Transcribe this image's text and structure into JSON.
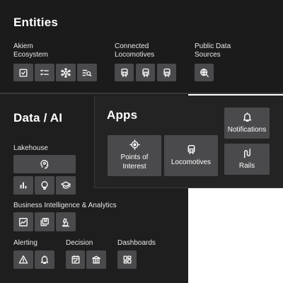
{
  "entities": {
    "title": "Entities",
    "akiem": {
      "label_line1": "Akiem",
      "label_line2": "Ecosystem",
      "icons": [
        "checkbox-icon",
        "checklist-icon",
        "network-hub-icon",
        "list-search-icon"
      ]
    },
    "connected": {
      "label_line1": "Connected",
      "label_line2": "Locomotives",
      "icons": [
        "train-front-icon",
        "train-front-icon",
        "train-front-icon"
      ]
    },
    "public": {
      "label_line1": "Public Data",
      "label_line2": "Sources",
      "icons": [
        "globe-search-icon"
      ]
    }
  },
  "data_ai": {
    "title": "Data / AI",
    "lakehouse": {
      "label": "Lakehouse",
      "icons": [
        "brain-head-icon",
        "bar-chart-icon",
        "lightbulb-icon",
        "graduation-cap-icon"
      ]
    },
    "bi": {
      "label": "Business Intelligence & Analytics",
      "icons": [
        "line-chart-icon",
        "layers-icon",
        "microscope-icon"
      ]
    },
    "alerting": {
      "label": "Alerting",
      "icons": [
        "warning-icon",
        "bell-icon"
      ]
    },
    "decision": {
      "label": "Decision",
      "icons": [
        "calendar-check-icon",
        "bank-icon"
      ]
    },
    "dashboards": {
      "label": "Dashboards",
      "icons": [
        "dashboard-grid-icon"
      ]
    }
  },
  "apps": {
    "title": "Apps",
    "tiles": [
      {
        "label_line1": "Points of",
        "label_line2": "Interest",
        "icon": "target-icon"
      },
      {
        "label_line1": "Locomotives",
        "label_line2": "",
        "icon": "train-front-icon"
      },
      {
        "label_line1": "Notifications",
        "label_line2": "",
        "icon": "bell-icon"
      },
      {
        "label_line1": "Rails",
        "label_line2": "",
        "icon": "rail-path-icon"
      }
    ]
  }
}
